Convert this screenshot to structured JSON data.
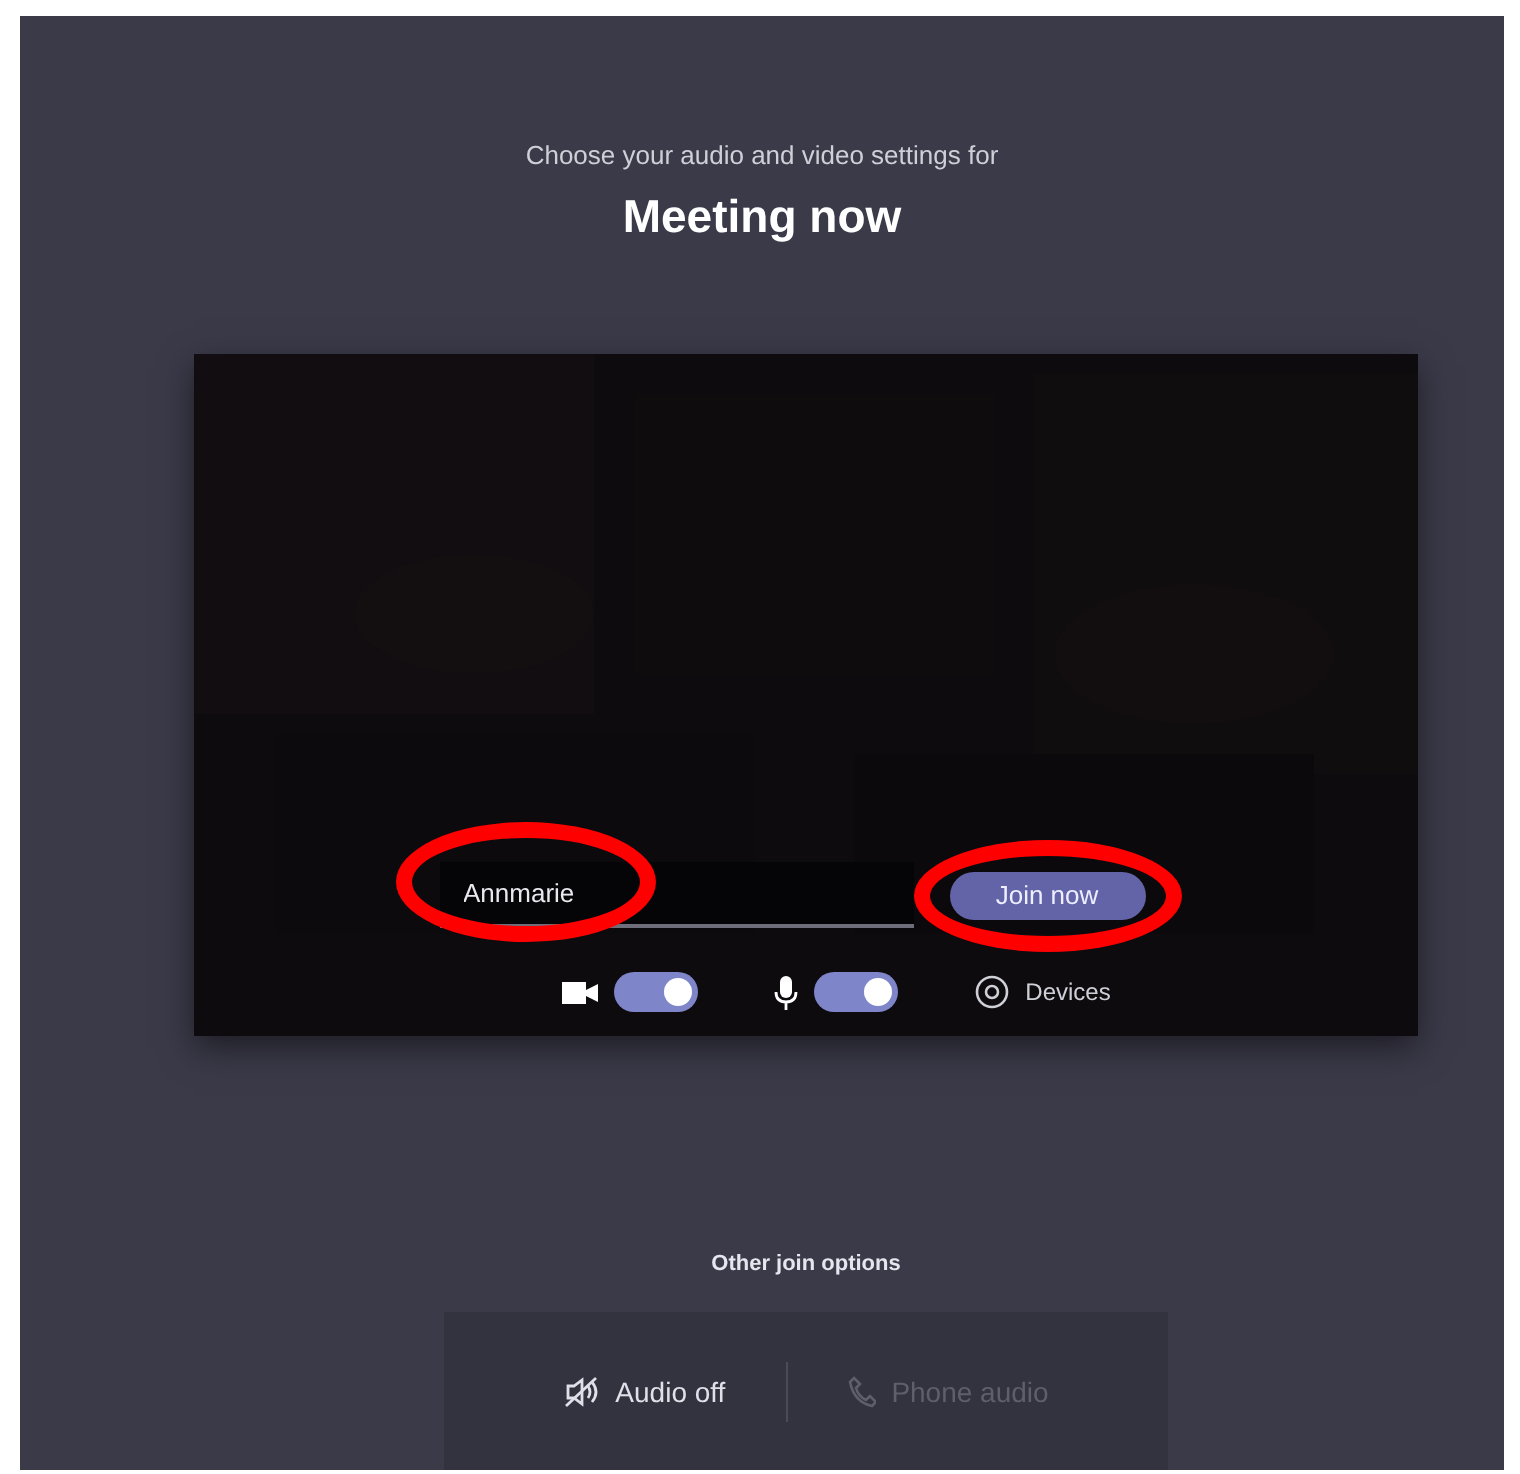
{
  "header": {
    "subtitle": "Choose your audio and video settings for",
    "title": "Meeting now"
  },
  "name_field": {
    "value": "Annmarie",
    "circled": true
  },
  "join_button": {
    "label": "Join now",
    "circled": true
  },
  "camera": {
    "on": true
  },
  "microphone": {
    "on": true
  },
  "devices_button": {
    "label": "Devices"
  },
  "other_options": {
    "heading": "Other join options",
    "items": [
      {
        "kind": "audio-off",
        "label": "Audio off",
        "disabled": false
      },
      {
        "kind": "phone",
        "label": "Phone audio",
        "disabled": true
      }
    ]
  }
}
